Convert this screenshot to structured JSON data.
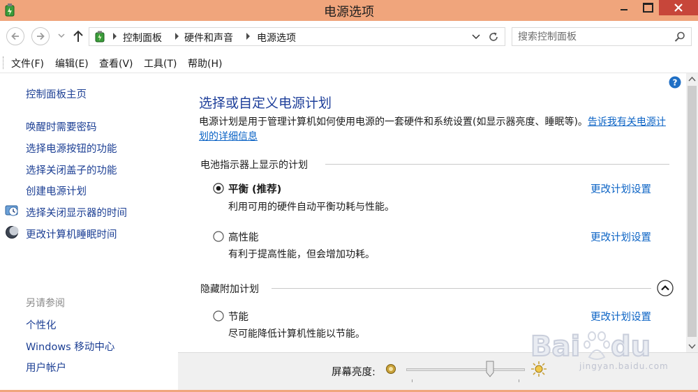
{
  "window": {
    "title": "电源选项"
  },
  "address": {
    "breadcrumbs": [
      "控制面板",
      "硬件和声音",
      "电源选项"
    ],
    "search_placeholder": "搜索控制面板"
  },
  "menu": {
    "items": [
      "文件(F)",
      "编辑(E)",
      "查看(V)",
      "工具(T)",
      "帮助(H)"
    ]
  },
  "sidebar": {
    "home": "控制面板主页",
    "tasks": [
      {
        "label": "唤醒时需要密码",
        "icon": ""
      },
      {
        "label": "选择电源按钮的功能",
        "icon": ""
      },
      {
        "label": "选择关闭盖子的功能",
        "icon": ""
      },
      {
        "label": "创建电源计划",
        "icon": ""
      },
      {
        "label": "选择关闭显示器的时间",
        "icon": "clock-icon"
      },
      {
        "label": "更改计算机睡眠时间",
        "icon": "moon-icon"
      }
    ],
    "see_also_title": "另请参阅",
    "see_also": [
      "个性化",
      "Windows 移动中心",
      "用户帐户"
    ]
  },
  "main": {
    "title": "选择或自定义电源计划",
    "description": "电源计划是用于管理计算机如何使用电源的一套硬件和系统设置(如显示器亮度、睡眠等)。",
    "description_link": "告诉我有关电源计划的详细信息",
    "section_battery": "电池指示器上显示的计划",
    "section_hidden": "隐藏附加计划",
    "change_plan_label": "更改计划设置",
    "plans": [
      {
        "name": "平衡 (推荐)",
        "desc": "利用可用的硬件自动平衡功耗与性能。",
        "selected": true
      },
      {
        "name": "高性能",
        "desc": "有利于提高性能，但会增加功耗。",
        "selected": false
      },
      {
        "name": "节能",
        "desc": "尽可能降低计算机性能以节能。",
        "selected": false
      }
    ]
  },
  "brightness": {
    "label": "屏幕亮度:",
    "level_percent": 72
  },
  "watermark": {
    "text": "jingyan.baidu.com"
  },
  "colors": {
    "titlebar": "#f0a57c",
    "close_button": "#c7463a",
    "link": "#0b63c5",
    "heading": "#1e3f9a"
  }
}
